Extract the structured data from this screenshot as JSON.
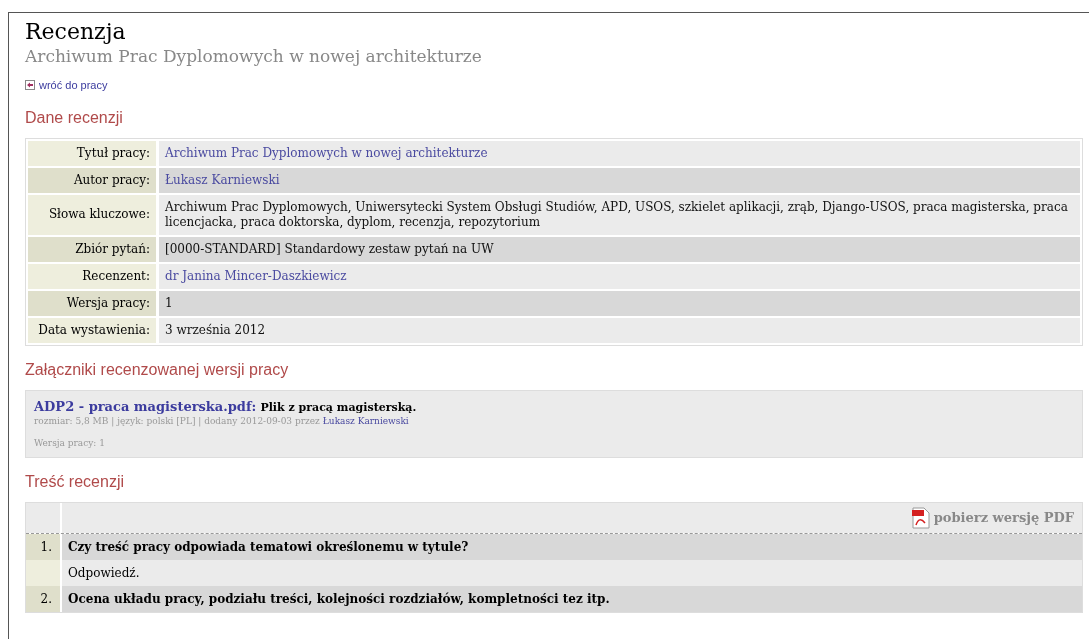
{
  "title": "Recenzja",
  "subtitle": "Archiwum Prac Dyplomowych w nowej architekturze",
  "back_link": "wróć do pracy",
  "details": {
    "heading": "Dane recenzji",
    "rows": [
      {
        "label": "Tytuł pracy:",
        "value": "Archiwum Prac Dyplomowych w nowej architekturze",
        "kind": "link"
      },
      {
        "label": "Autor pracy:",
        "value": "Łukasz Karniewski",
        "kind": "link"
      },
      {
        "label": "Słowa kluczowe:",
        "value": "Archiwum Prac Dyplomowych, Uniwersytecki System Obsługi Studiów, APD, USOS, szkielet aplikacji, zrąb, Django-USOS, praca magisterska, praca licencjacka, praca doktorska, dyplom, recenzja, repozytorium",
        "kind": "text"
      },
      {
        "label": "Zbiór pytań:",
        "value": "[0000-STANDARD] Standardowy zestaw pytań na UW",
        "kind": "text"
      },
      {
        "label": "Recenzent:",
        "value": "dr Janina Mincer-Daszkiewicz",
        "kind": "link"
      },
      {
        "label": "Wersja pracy:",
        "value": "1",
        "kind": "text"
      },
      {
        "label": "Data wystawienia:",
        "value": "3 września 2012",
        "kind": "text"
      }
    ]
  },
  "attachments": {
    "heading": "Załączniki recenzowanej wersji pracy",
    "file": {
      "name": "ADP2 - praca magisterska.pdf",
      "separator": ":",
      "description": "Plik z pracą magisterską.",
      "meta": "rozmiar: 5,8 MB | język: polski [PL] | dodany 2012-09-03 przez",
      "author": "Łukasz Karniewski",
      "version": "Wersja pracy: 1"
    }
  },
  "review": {
    "heading": "Treść recenzji",
    "pdf_link": "pobierz wersję PDF",
    "items": [
      {
        "number": "1.",
        "question": "Czy treść pracy odpowiada tematowi określonemu w tytule?",
        "answer": "Odpowiedź."
      },
      {
        "number": "2.",
        "question": "Ocena układu pracy, podziału treści, kolejności rozdziałów, kompletności tez itp."
      }
    ]
  }
}
